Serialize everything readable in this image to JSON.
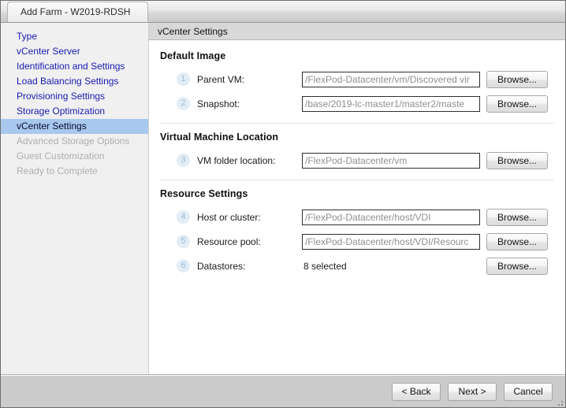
{
  "window": {
    "title": "Add Farm - W2019-RDSH"
  },
  "sidebar": {
    "items": [
      {
        "label": "Type",
        "state": "enabled"
      },
      {
        "label": "vCenter Server",
        "state": "enabled"
      },
      {
        "label": "Identification and Settings",
        "state": "enabled"
      },
      {
        "label": "Load Balancing Settings",
        "state": "enabled"
      },
      {
        "label": "Provisioning Settings",
        "state": "enabled"
      },
      {
        "label": "Storage Optimization",
        "state": "enabled"
      },
      {
        "label": "vCenter Settings",
        "state": "selected"
      },
      {
        "label": "Advanced Storage Options",
        "state": "disabled"
      },
      {
        "label": "Guest Customization",
        "state": "disabled"
      },
      {
        "label": "Ready to Complete",
        "state": "disabled"
      }
    ]
  },
  "panel": {
    "header_title": "vCenter Settings",
    "sections": [
      {
        "title": "Default Image",
        "rows": [
          {
            "number": "1",
            "label": "Parent VM:",
            "value": "/FlexPod-Datacenter/vm/Discovered vir",
            "button": "Browse..."
          },
          {
            "number": "2",
            "label": "Snapshot:",
            "value": "/base/2019-lc-master1/master2/maste",
            "button": "Browse..."
          }
        ]
      },
      {
        "title": "Virtual Machine Location",
        "rows": [
          {
            "number": "3",
            "label": "VM folder location:",
            "value": "/FlexPod-Datacenter/vm",
            "button": "Browse..."
          }
        ]
      },
      {
        "title": "Resource Settings",
        "rows": [
          {
            "number": "4",
            "label": "Host or cluster:",
            "value": "/FlexPod-Datacenter/host/VDI",
            "button": "Browse..."
          },
          {
            "number": "5",
            "label": "Resource pool:",
            "value": "/FlexPod-Datacenter/host/VDI/Resourc",
            "button": "Browse..."
          },
          {
            "number": "6",
            "label": "Datastores:",
            "static_value": "8 selected",
            "button": "Browse..."
          }
        ]
      }
    ]
  },
  "footer": {
    "back_label": "< Back",
    "next_label": "Next >",
    "cancel_label": "Cancel"
  },
  "colors": {
    "link": "#1a1ab4",
    "selection": "#a8c8ee",
    "disabled": "#aeaeae",
    "badge_bg": "#e2edf6",
    "badge_fg": "#9cbbd4"
  }
}
